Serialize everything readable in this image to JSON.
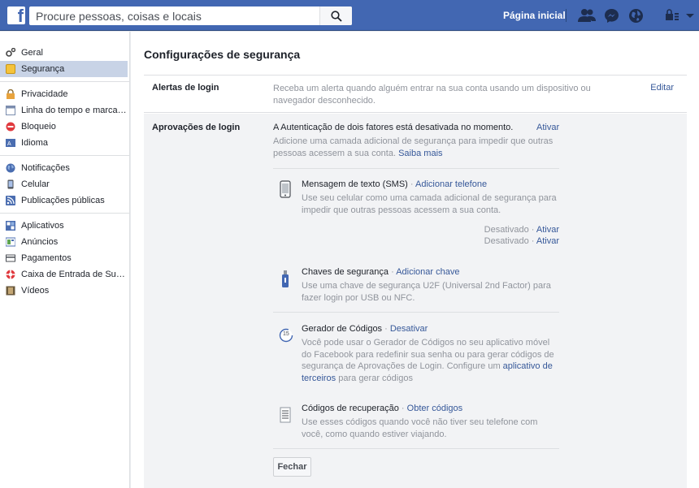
{
  "colors": {
    "brand": "#4267b2",
    "link": "#365899",
    "muted": "#90949c",
    "selected": "#c8d3e6"
  },
  "topbar": {
    "logo": "f",
    "search_placeholder": "Procure pessoas, coisas e locais",
    "home_label": "Página inicial",
    "icons": [
      "friend-requests-icon",
      "messenger-icon",
      "globe-notifications-icon",
      "privacy-shortcuts-icon",
      "account-menu-icon"
    ]
  },
  "sidebar": {
    "groups": [
      [
        {
          "label": "Geral",
          "icon": "gear-icon"
        },
        {
          "label": "Segurança",
          "icon": "shield-icon",
          "selected": true
        }
      ],
      [
        {
          "label": "Privacidade",
          "icon": "lock-icon"
        },
        {
          "label": "Linha do tempo e marcação",
          "icon": "timeline-icon"
        },
        {
          "label": "Bloqueio",
          "icon": "block-icon"
        },
        {
          "label": "Idioma",
          "icon": "language-icon"
        }
      ],
      [
        {
          "label": "Notificações",
          "icon": "globe-icon"
        },
        {
          "label": "Celular",
          "icon": "phone-icon"
        },
        {
          "label": "Publicações públicas",
          "icon": "rss-icon"
        }
      ],
      [
        {
          "label": "Aplicativos",
          "icon": "apps-icon"
        },
        {
          "label": "Anúncios",
          "icon": "ads-icon"
        },
        {
          "label": "Pagamentos",
          "icon": "card-icon"
        },
        {
          "label": "Caixa de Entrada de Suporte",
          "icon": "lifebuoy-icon"
        },
        {
          "label": "Vídeos",
          "icon": "film-icon"
        }
      ]
    ]
  },
  "main": {
    "title": "Configurações de segurança",
    "alerts": {
      "label": "Alertas de login",
      "description": "Receba um alerta quando alguém entrar na sua conta usando um dispositivo ou navegador desconhecido.",
      "edit": "Editar"
    },
    "approvals": {
      "label": "Aprovações de login",
      "status": "A Autenticação de dois fatores está desativada no momento.",
      "activate": "Ativar",
      "description": "Adicione uma camada adicional de segurança para impedir que outras pessoas acessem a sua conta.",
      "learn_more": "Saiba mais",
      "sms": {
        "title": "Mensagem de texto (SMS)",
        "sep": " · ",
        "action": "Adicionar telefone",
        "description": "Use seu celular como uma camada adicional de segurança para impedir que outras pessoas acessem a sua conta.",
        "status_rows": [
          {
            "state": "Desativado",
            "sep": " · ",
            "action": "Ativar"
          },
          {
            "state": "Desativado",
            "sep": " · ",
            "action": "Ativar"
          }
        ]
      },
      "keys": {
        "title": "Chaves de segurança",
        "sep": " · ",
        "action": "Adicionar chave",
        "description": "Use uma chave de segurança U2F (Universal 2nd Factor) para fazer login por USB ou NFC."
      },
      "generator": {
        "title": "Gerador de Códigos",
        "sep": " · ",
        "action": "Desativar",
        "description_pre": "Você pode usar o Gerador de Códigos no seu aplicativo móvel do Facebook para redefinir sua senha ou para gerar códigos de segurança de Aprovações de Login. Configure um ",
        "description_link": "aplicativo de terceiros",
        "description_post": " para gerar códigos",
        "icon_text": "15"
      },
      "recovery": {
        "title": "Códigos de recuperação",
        "sep": " · ",
        "action": "Obter códigos",
        "description": "Use esses códigos quando você não tiver seu telefone com você, como quando estiver viajando."
      },
      "close": "Fechar"
    }
  }
}
